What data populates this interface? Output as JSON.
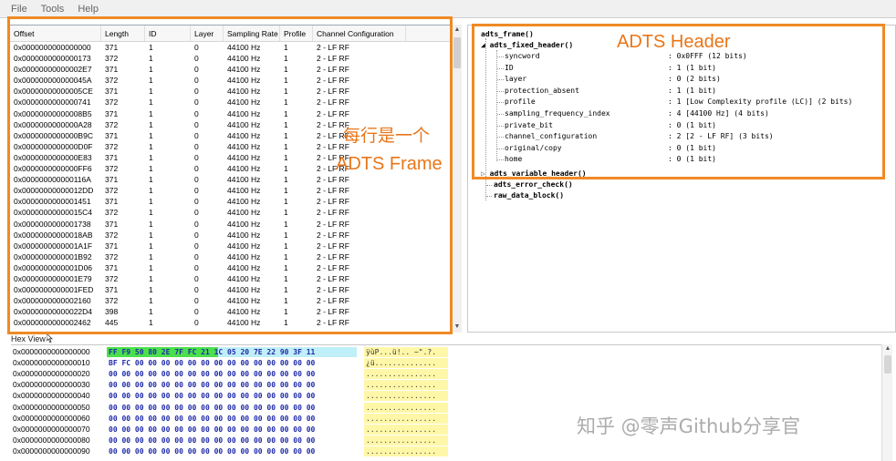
{
  "menu": [
    "File",
    "Tools",
    "Help"
  ],
  "table": {
    "columns": [
      "Offset",
      "Length",
      "ID",
      "Layer",
      "Sampling Rate",
      "Profile",
      "Channel Configuration"
    ],
    "rows": [
      [
        "0x0000000000000000",
        "371",
        "1",
        "0",
        "44100 Hz",
        "1",
        "2 - LF RF"
      ],
      [
        "0x0000000000000173",
        "372",
        "1",
        "0",
        "44100 Hz",
        "1",
        "2 - LF RF"
      ],
      [
        "0x00000000000002E7",
        "371",
        "1",
        "0",
        "44100 Hz",
        "1",
        "2 - LF RF"
      ],
      [
        "0x000000000000045A",
        "372",
        "1",
        "0",
        "44100 Hz",
        "1",
        "2 - LF RF"
      ],
      [
        "0x00000000000005CE",
        "371",
        "1",
        "0",
        "44100 Hz",
        "1",
        "2 - LF RF"
      ],
      [
        "0x0000000000000741",
        "372",
        "1",
        "0",
        "44100 Hz",
        "1",
        "2 - LF RF"
      ],
      [
        "0x00000000000008B5",
        "371",
        "1",
        "0",
        "44100 Hz",
        "1",
        "2 - LF RF"
      ],
      [
        "0x0000000000000A28",
        "372",
        "1",
        "0",
        "44100 Hz",
        "1",
        "2 - LF RF"
      ],
      [
        "0x0000000000000B9C",
        "371",
        "1",
        "0",
        "44100 Hz",
        "1",
        "2 - LF RF"
      ],
      [
        "0x0000000000000D0F",
        "372",
        "1",
        "0",
        "44100 Hz",
        "1",
        "2 - LF RF"
      ],
      [
        "0x0000000000000E83",
        "371",
        "1",
        "0",
        "44100 Hz",
        "1",
        "2 - LF RF"
      ],
      [
        "0x0000000000000FF6",
        "372",
        "1",
        "0",
        "44100 Hz",
        "1",
        "2 - LF RF"
      ],
      [
        "0x000000000000116A",
        "371",
        "1",
        "0",
        "44100 Hz",
        "1",
        "2 - LF RF"
      ],
      [
        "0x00000000000012DD",
        "372",
        "1",
        "0",
        "44100 Hz",
        "1",
        "2 - LF RF"
      ],
      [
        "0x0000000000001451",
        "371",
        "1",
        "0",
        "44100 Hz",
        "1",
        "2 - LF RF"
      ],
      [
        "0x00000000000015C4",
        "372",
        "1",
        "0",
        "44100 Hz",
        "1",
        "2 - LF RF"
      ],
      [
        "0x0000000000001738",
        "371",
        "1",
        "0",
        "44100 Hz",
        "1",
        "2 - LF RF"
      ],
      [
        "0x00000000000018AB",
        "372",
        "1",
        "0",
        "44100 Hz",
        "1",
        "2 - LF RF"
      ],
      [
        "0x0000000000001A1F",
        "371",
        "1",
        "0",
        "44100 Hz",
        "1",
        "2 - LF RF"
      ],
      [
        "0x0000000000001B92",
        "372",
        "1",
        "0",
        "44100 Hz",
        "1",
        "2 - LF RF"
      ],
      [
        "0x0000000000001D06",
        "371",
        "1",
        "0",
        "44100 Hz",
        "1",
        "2 - LF RF"
      ],
      [
        "0x0000000000001E79",
        "372",
        "1",
        "0",
        "44100 Hz",
        "1",
        "2 - LF RF"
      ],
      [
        "0x0000000000001FED",
        "371",
        "1",
        "0",
        "44100 Hz",
        "1",
        "2 - LF RF"
      ],
      [
        "0x0000000000002160",
        "372",
        "1",
        "0",
        "44100 Hz",
        "1",
        "2 - LF RF"
      ],
      [
        "0x00000000000022D4",
        "398",
        "1",
        "0",
        "44100 Hz",
        "1",
        "2 - LF RF"
      ],
      [
        "0x0000000000002462",
        "445",
        "1",
        "0",
        "44100 Hz",
        "1",
        "2 - LF RF"
      ]
    ]
  },
  "tree": {
    "root": "adts_frame()",
    "fixed_header": "adts_fixed_header()",
    "fields": [
      {
        "name": "syncword",
        "value": ": 0x0FFF (12 bits)"
      },
      {
        "name": "ID",
        "value": ": 1 (1 bit)"
      },
      {
        "name": "layer",
        "value": ": 0 (2 bits)"
      },
      {
        "name": "protection_absent",
        "value": ": 1 (1 bit)"
      },
      {
        "name": "profile",
        "value": ": 1 [Low Complexity profile (LC)] (2 bits)"
      },
      {
        "name": "sampling_frequency_index",
        "value": ": 4 [44100 Hz] (4 bits)"
      },
      {
        "name": "private_bit",
        "value": ": 0 (1 bit)"
      },
      {
        "name": "channel_configuration",
        "value": ": 2 [2 - LF RF] (3 bits)"
      },
      {
        "name": "original/copy",
        "value": ": 0 (1 bit)"
      },
      {
        "name": "home",
        "value": ": 0 (1 bit)"
      }
    ],
    "variable_header": "adts_variable_header()",
    "error_check": "adts_error_check()",
    "raw_data": "raw_data_block()"
  },
  "hex": {
    "title": "Hex View",
    "rows": [
      {
        "offset": "0x0000000000000000",
        "bytes": "FF F9 50 80 2E 7F FC 21 1C 05 20 7E 22 90 3F 11",
        "ascii": "ÿùP...ü!.. ~\".?."
      },
      {
        "offset": "0x0000000000000010",
        "bytes": "BF FC 00 00 00 00 00 00 00 00 00 00 00 00 00 00",
        "ascii": "¿ü.............."
      },
      {
        "offset": "0x0000000000000020",
        "bytes": "00 00 00 00 00 00 00 00 00 00 00 00 00 00 00 00",
        "ascii": "................"
      },
      {
        "offset": "0x0000000000000030",
        "bytes": "00 00 00 00 00 00 00 00 00 00 00 00 00 00 00 00",
        "ascii": "................"
      },
      {
        "offset": "0x0000000000000040",
        "bytes": "00 00 00 00 00 00 00 00 00 00 00 00 00 00 00 00",
        "ascii": "................"
      },
      {
        "offset": "0x0000000000000050",
        "bytes": "00 00 00 00 00 00 00 00 00 00 00 00 00 00 00 00",
        "ascii": "................"
      },
      {
        "offset": "0x0000000000000060",
        "bytes": "00 00 00 00 00 00 00 00 00 00 00 00 00 00 00 00",
        "ascii": "................"
      },
      {
        "offset": "0x0000000000000070",
        "bytes": "00 00 00 00 00 00 00 00 00 00 00 00 00 00 00 00",
        "ascii": "................"
      },
      {
        "offset": "0x0000000000000080",
        "bytes": "00 00 00 00 00 00 00 00 00 00 00 00 00 00 00 00",
        "ascii": "................"
      },
      {
        "offset": "0x0000000000000090",
        "bytes": "00 00 00 00 00 00 00 00 00 00 00 00 00 00 00 00",
        "ascii": "................"
      }
    ]
  },
  "annotations": {
    "header_label": "ADTS Header",
    "row_label_cn": "每行是一个",
    "row_label_en": "ADTS Frame",
    "color": "#f08a24"
  },
  "watermark": "知乎 @零声Github分享官"
}
